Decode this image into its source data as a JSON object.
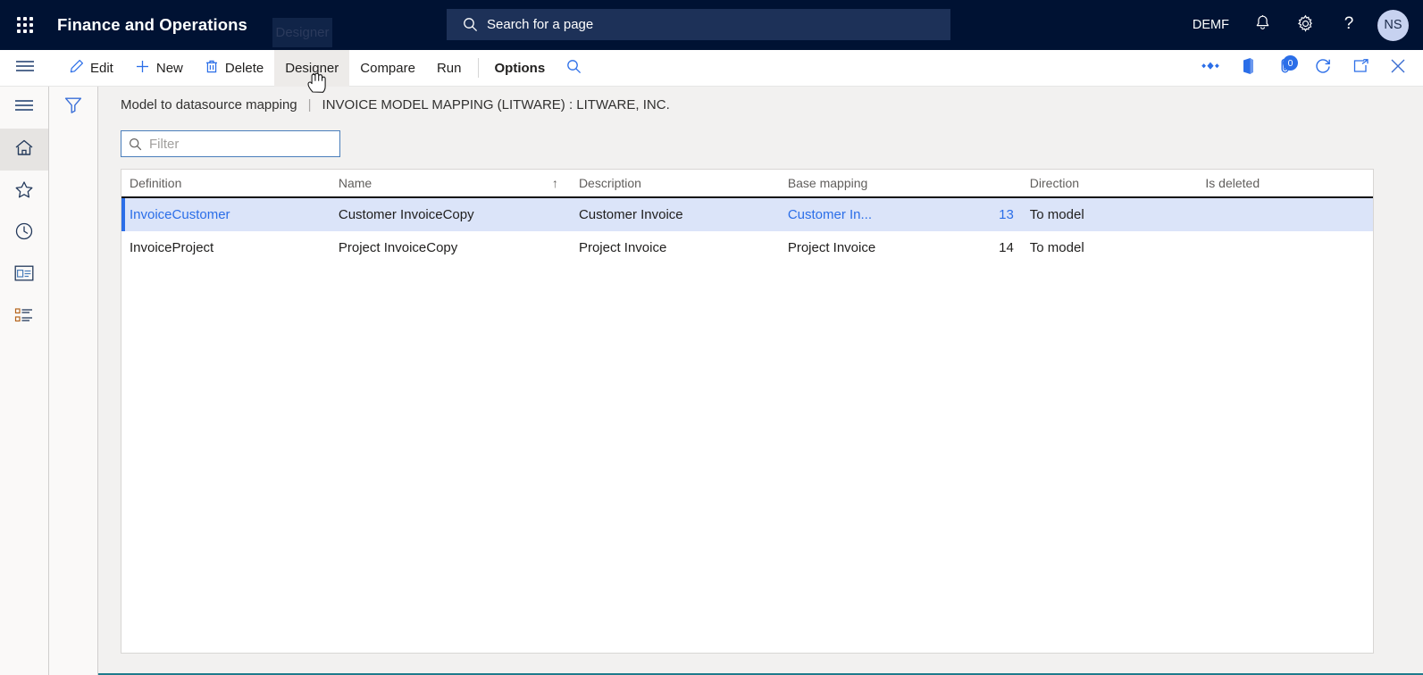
{
  "topbar": {
    "app_title": "Finance and Operations",
    "waffle_icon": "app-launcher-icon",
    "ghost_tooltip": "Designer",
    "search": {
      "placeholder": "Search for a page",
      "icon": "search-icon"
    },
    "company": "DEMF",
    "notifications_icon": "bell-icon",
    "settings_icon": "gear-icon",
    "help_icon": "question-mark-icon",
    "avatar_initials": "NS"
  },
  "commandbar": {
    "hamburger_icon": "hamburger-menu-icon",
    "buttons": [
      {
        "label": "Edit",
        "icon": "pencil-icon",
        "bold": false,
        "hovered": false
      },
      {
        "label": "New",
        "icon": "plus-icon",
        "bold": false,
        "hovered": false
      },
      {
        "label": "Delete",
        "icon": "trash-icon",
        "bold": false,
        "hovered": false
      },
      {
        "label": "Designer",
        "icon": "",
        "bold": false,
        "hovered": true
      },
      {
        "label": "Compare",
        "icon": "",
        "bold": false,
        "hovered": false
      },
      {
        "label": "Run",
        "icon": "",
        "bold": false,
        "hovered": false
      },
      {
        "label": "Options",
        "icon": "",
        "bold": true,
        "hovered": false
      }
    ],
    "search_icon": "search-icon",
    "right_icons": [
      {
        "name": "diamonds-icon",
        "badge": null
      },
      {
        "name": "office-book-icon",
        "badge": null
      },
      {
        "name": "attachments-icon",
        "badge": "0"
      },
      {
        "name": "refresh-icon",
        "badge": null
      },
      {
        "name": "popout-icon",
        "badge": null
      },
      {
        "name": "close-icon",
        "badge": null
      }
    ]
  },
  "rail": {
    "items": [
      {
        "name": "hamburger-menu-icon",
        "active": false
      },
      {
        "name": "home-icon",
        "active": true
      },
      {
        "name": "favorites-star-icon",
        "active": false
      },
      {
        "name": "recent-clock-icon",
        "active": false
      },
      {
        "name": "workspaces-icon",
        "active": false
      },
      {
        "name": "modules-list-icon",
        "active": false
      }
    ]
  },
  "filterpane": {
    "icon": "filter-funnel-icon"
  },
  "page": {
    "breadcrumb_caption": "Model to datasource mapping",
    "breadcrumb_separator": "|",
    "breadcrumb_title": "INVOICE MODEL MAPPING (LITWARE) : LITWARE, INC."
  },
  "filter": {
    "placeholder": "Filter",
    "value": "",
    "icon": "search-icon"
  },
  "grid": {
    "columns": [
      {
        "key": "definition",
        "label": "Definition",
        "sorted": false
      },
      {
        "key": "name",
        "label": "Name",
        "sorted": true,
        "sort_direction": "↑"
      },
      {
        "key": "description",
        "label": "Description",
        "sorted": false
      },
      {
        "key": "base_mapping",
        "label": "Base mapping",
        "sorted": false
      },
      {
        "key": "direction",
        "label": "Direction",
        "sorted": false
      },
      {
        "key": "is_deleted",
        "label": "Is deleted",
        "sorted": false
      }
    ],
    "rows": [
      {
        "definition": "InvoiceCustomer",
        "name": "Customer InvoiceCopy",
        "description": "Customer Invoice",
        "base_mapping": "Customer In...",
        "direction_number": "13",
        "direction": "To model",
        "is_deleted": "",
        "selected": true
      },
      {
        "definition": "InvoiceProject",
        "name": "Project InvoiceCopy",
        "description": "Project Invoice",
        "base_mapping": "Project Invoice",
        "direction_number": "14",
        "direction": "To model",
        "is_deleted": "",
        "selected": false
      }
    ]
  },
  "colors": {
    "nav_background": "#001233",
    "accent_blue": "#2b6ee8",
    "selected_row": "#dbe4f9",
    "page_background": "#f2f1f0",
    "bottom_border": "#1e7b8c"
  }
}
